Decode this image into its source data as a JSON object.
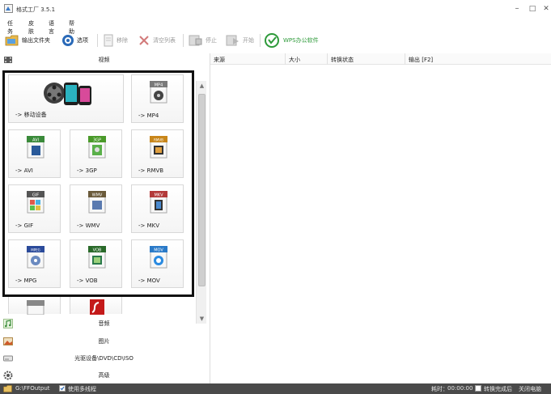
{
  "window": {
    "title": "格式工厂 3.5.1",
    "controls": {
      "minimize": "–",
      "maximize": "□",
      "close": "✕"
    }
  },
  "menu": [
    "任务",
    "皮肤",
    "语言",
    "帮助"
  ],
  "toolbar": {
    "output_folder": "输出文件夹",
    "options": "选项",
    "remove": "移除",
    "clear_list": "清空列表",
    "stop": "停止",
    "start": "开始",
    "wps": "WPS办公软件",
    "wps_color": "#2e9a3a"
  },
  "categories": {
    "video": "视频",
    "audio": "音频",
    "image": "图片",
    "rom": "光驱设备\\DVD\\CD\\ISO",
    "advanced": "高级"
  },
  "video_tiles": [
    {
      "label": "-> 移动设备",
      "icon": "mobile-devices-icon"
    },
    {
      "label": "-> MP4",
      "icon": "mp4-file-icon",
      "badge": "MP4",
      "badge_color": "#7a7a7a"
    },
    {
      "label": "-> AVI",
      "icon": "avi-file-icon",
      "badge": "AVI",
      "badge_color": "#3a8a3a"
    },
    {
      "label": "-> 3GP",
      "icon": "3gp-file-icon",
      "badge": "3GP",
      "badge_color": "#4a9a2a"
    },
    {
      "label": "-> RMVB",
      "icon": "rmvb-file-icon",
      "badge": "RMVB",
      "badge_color": "#c8861a"
    },
    {
      "label": "-> GIF",
      "icon": "gif-file-icon",
      "badge": "GIF",
      "badge_color": "#555555"
    },
    {
      "label": "-> WMV",
      "icon": "wmv-file-icon",
      "badge": "WMV",
      "badge_color": "#6a5a3a"
    },
    {
      "label": "-> MKV",
      "icon": "mkv-file-icon",
      "badge": "MKV",
      "badge_color": "#b33a3a"
    },
    {
      "label": "-> MPG",
      "icon": "mpg-file-icon",
      "badge": "MPEG",
      "badge_color": "#2a4a9a"
    },
    {
      "label": "-> VOB",
      "icon": "vob-file-icon",
      "badge": "VOB",
      "badge_color": "#2a6a2a"
    },
    {
      "label": "-> MOV",
      "icon": "mov-file-icon",
      "badge": "MOV",
      "badge_color": "#2a7ac8"
    }
  ],
  "list_columns": [
    "来源",
    "大小",
    "转换状态",
    "输出 [F2]"
  ],
  "status": {
    "output_path": "G:\\FFOutput",
    "use_multithread": "使用多线程",
    "elapsed_label": "耗时：",
    "elapsed_value": "00:00:00",
    "after_convert": "转换完成后",
    "shutdown": "关闭电脑"
  }
}
